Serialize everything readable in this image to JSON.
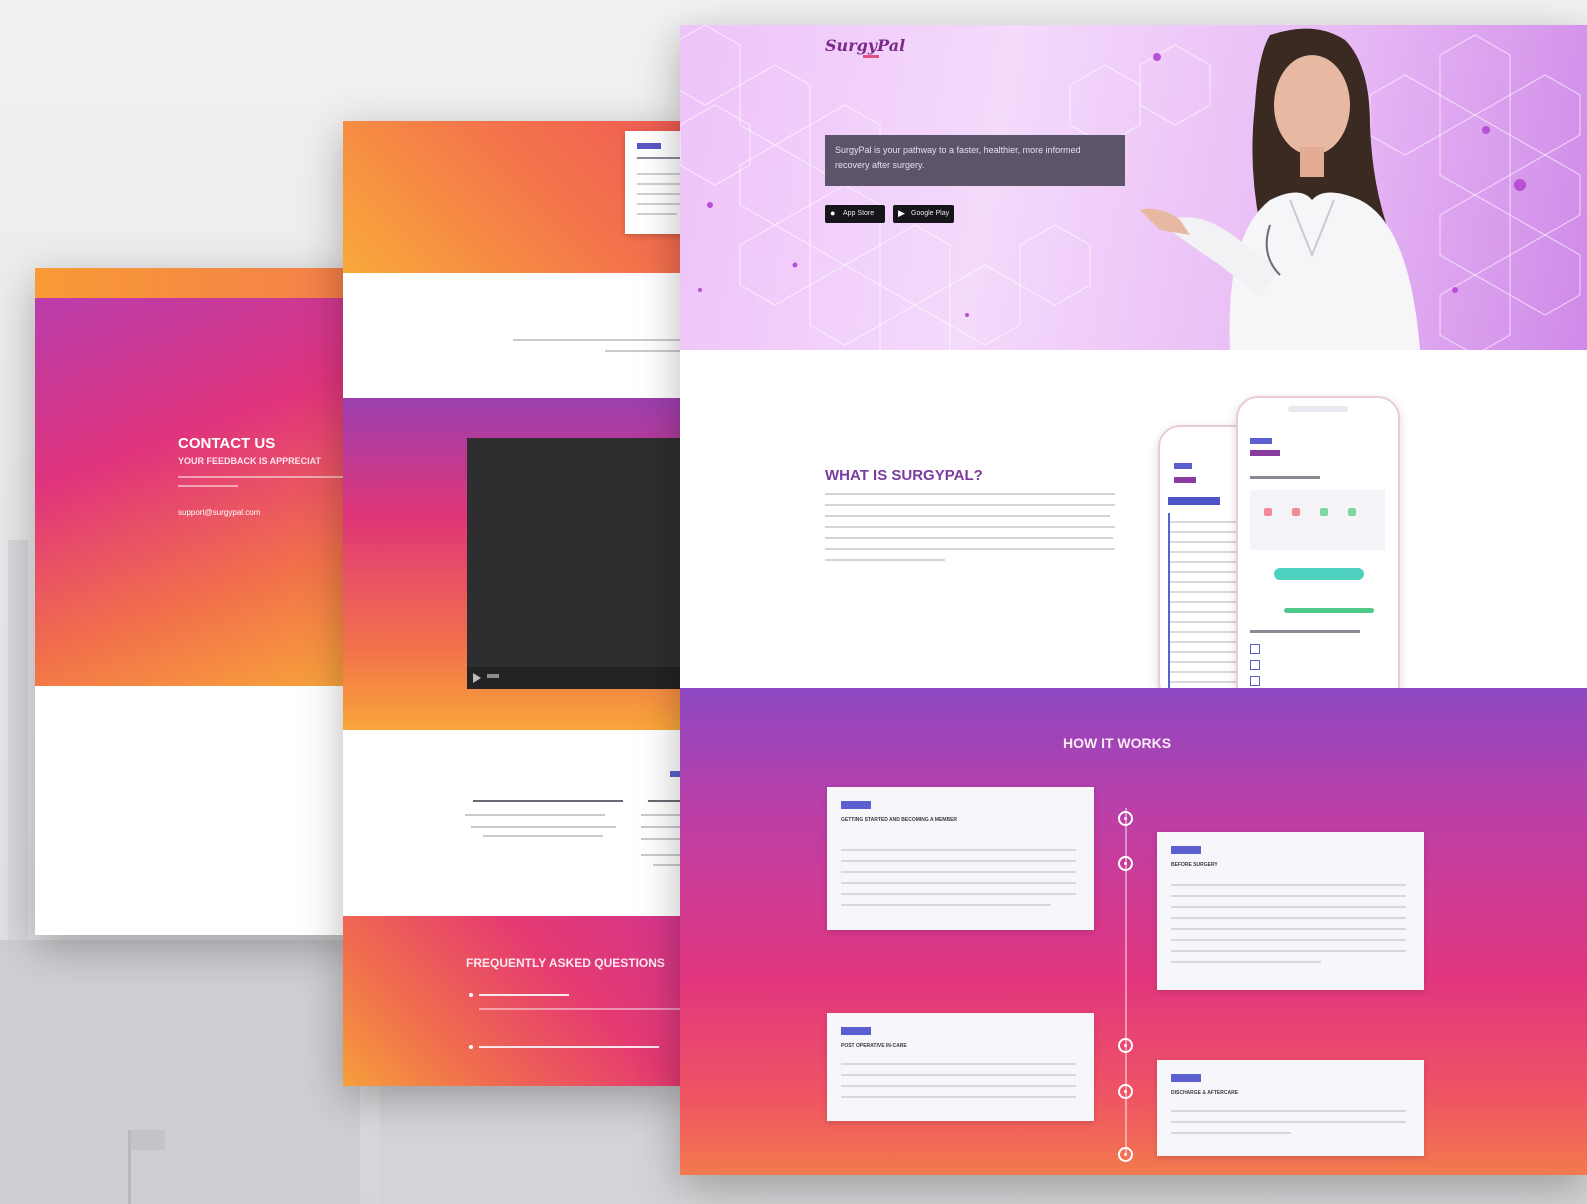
{
  "colors": {
    "brand_purple": "#7a3a9e",
    "brand_pink": "#e2367e",
    "brand_orange": "#f8a53a",
    "badge_blue": "#5b5fd0"
  },
  "contact": {
    "title": "CONTACT US",
    "subtitle": "YOUR FEEDBACK IS APPRECIAT",
    "email": "support@surgypal.com"
  },
  "faq": {
    "title": "FREQUENTLY ASKED QUESTIONS"
  },
  "hero": {
    "logo_text": "SurgyPal",
    "tagline": "SurgyPal is your pathway to a faster, healthier, more informed recovery after surgery.",
    "app_store_label": "App Store",
    "google_play_label": "Google Play",
    "app_store_icon": "apple-icon",
    "google_play_icon": "play-store-icon"
  },
  "what": {
    "title": "WHAT IS SURGYPAL?"
  },
  "how": {
    "title": "HOW IT WORKS",
    "steps": [
      {
        "title": "GETTING STARTED AND BECOMING A MEMBER"
      },
      {
        "title": "BEFORE SURGERY"
      },
      {
        "title": "POST OPERATIVE IN-CARE"
      },
      {
        "title": "DISCHARGE & AFTERCARE"
      }
    ]
  }
}
